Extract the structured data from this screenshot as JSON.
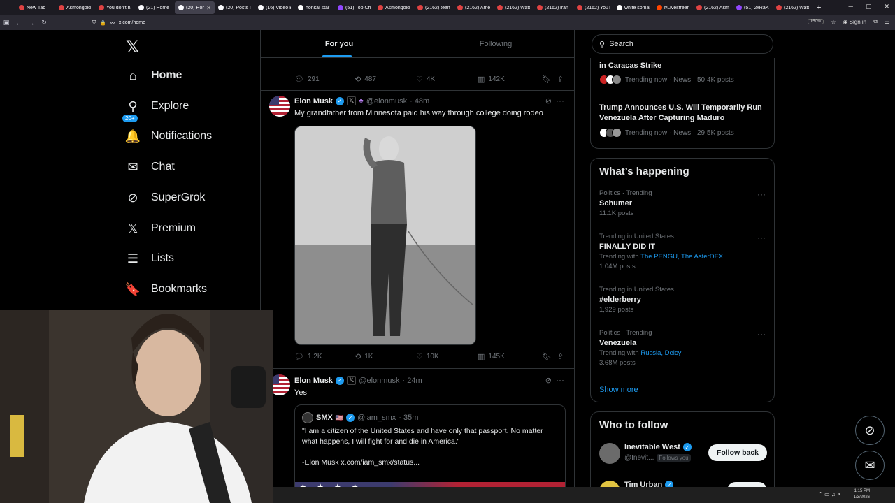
{
  "browser": {
    "tabs": [
      {
        "title": "New Tab",
        "color": "#e04343"
      },
      {
        "title": "Asmongold",
        "color": "#e04343"
      },
      {
        "title": "You don't ha",
        "color": "#e04343"
      },
      {
        "title": "(21) Home /",
        "color": "#fbfbfe"
      },
      {
        "title": "(20) Home",
        "color": "#fbfbfe",
        "active": true
      },
      {
        "title": "(20) Posts lik",
        "color": "#fbfbfe"
      },
      {
        "title": "(16) Video E",
        "color": "#fbfbfe"
      },
      {
        "title": "honkai star r",
        "color": "#ffffff"
      },
      {
        "title": "(51) Top Cha",
        "color": "#9147ff"
      },
      {
        "title": "Asmongold",
        "color": "#e04343"
      },
      {
        "title": "(2162) team",
        "color": "#e04343"
      },
      {
        "title": "(2162) Ameri",
        "color": "#e04343"
      },
      {
        "title": "(2162) Watch",
        "color": "#e04343"
      },
      {
        "title": "(2162) iran p",
        "color": "#e04343"
      },
      {
        "title": "(2162) YouTu",
        "color": "#e04343"
      },
      {
        "title": "white somali",
        "color": "#ffffff"
      },
      {
        "title": "r/Livestream",
        "color": "#ff4500"
      },
      {
        "title": "(2162) Asmo",
        "color": "#e04343"
      },
      {
        "title": "(51) 2xRaKai",
        "color": "#9147ff"
      },
      {
        "title": "(2162) Watch",
        "color": "#e04343"
      }
    ],
    "url": "x.com/home",
    "zoom": "150%",
    "sign_in": "Sign in"
  },
  "nav": {
    "items": [
      {
        "label": "Home",
        "icon": "home-icon",
        "glyph": "⌂",
        "bold": true
      },
      {
        "label": "Explore",
        "icon": "search-icon",
        "glyph": "⚲"
      },
      {
        "label": "Notifications",
        "icon": "bell-icon",
        "glyph": "🔔",
        "badge": "20+"
      },
      {
        "label": "Chat",
        "icon": "mail-icon",
        "glyph": "✉"
      },
      {
        "label": "SuperGrok",
        "icon": "grok-icon",
        "glyph": "⊘"
      },
      {
        "label": "Premium",
        "icon": "x-logo-icon",
        "glyph": "𝕏"
      },
      {
        "label": "Lists",
        "icon": "list-icon",
        "glyph": "☰"
      },
      {
        "label": "Bookmarks",
        "icon": "bookmark-icon",
        "glyph": "🔖"
      }
    ]
  },
  "feed": {
    "tabs": [
      "For you",
      "Following"
    ],
    "prev_actions": {
      "replies": "291",
      "reposts": "487",
      "likes": "4K",
      "views": "142K"
    },
    "tweet1": {
      "name": "Elon Musk",
      "handle": "@elonmusk",
      "time": "· 48m",
      "text": "My grandfather from Minnesota paid his way through college doing rodeo",
      "replies": "1.2K",
      "reposts": "1K",
      "likes": "10K",
      "views": "145K"
    },
    "tweet2": {
      "name": "Elon Musk",
      "handle": "@elonmusk",
      "time": "· 24m",
      "text": "Yes",
      "quote": {
        "name": "SMX",
        "handle": "@iam_smx",
        "time": "· 35m",
        "line1": "\"I am a citizen of the United States and have only that passport. No matter what happens, I will fight for and die in America.\"",
        "line2": "-Elon Musk  x.com/iam_smx/status..."
      }
    }
  },
  "sidebar": {
    "search_placeholder": "Search",
    "news": [
      {
        "title": "in Caracas Strike",
        "meta": "Trending now · News · 50.4K posts"
      },
      {
        "title": "Trump Announces U.S. Will Temporarily Run Venezuela After Capturing Maduro",
        "meta": "Trending now · News · 29.5K posts"
      }
    ],
    "whats_happening": {
      "title": "What’s happening",
      "trends": [
        {
          "context": "Politics · Trending",
          "topic": "Schumer",
          "posts": "11.1K posts"
        },
        {
          "context": "Trending in United States",
          "topic": "FINALLY DID IT",
          "with_label": "Trending with",
          "with_links": "The PENGU, The AsterDEX",
          "posts": "1.04M posts"
        },
        {
          "context": "Trending in United States",
          "topic": "#elderberry",
          "posts": "1,929 posts"
        },
        {
          "context": "Politics · Trending",
          "topic": "Venezuela",
          "with_label": "Trending with",
          "with_links": "Russia, Delcy",
          "posts": "3.68M posts"
        }
      ],
      "show_more": "Show more"
    },
    "who_to_follow": {
      "title": "Who to follow",
      "users": [
        {
          "name": "Inevitable West",
          "handle": "@Inevit...",
          "follows_you": "Follows you",
          "button": "Follow back"
        },
        {
          "name": "Tim Urban",
          "handle": "",
          "button": "Follow"
        }
      ]
    }
  },
  "taskbar": {
    "time": "1:15 PM",
    "date": "1/3/2026"
  }
}
